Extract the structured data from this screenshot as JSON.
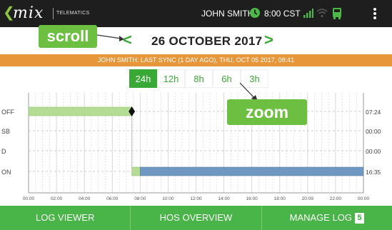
{
  "header": {
    "logo": "mix",
    "brand_sub": "TELEMATICS",
    "user": "JOHN SMITH",
    "time": "8:00 CST",
    "icons": [
      "back-chevron-icon",
      "clock-icon",
      "signal-icon",
      "wifi-icon",
      "truck-icon",
      "overflow-menu-icon"
    ]
  },
  "datebar": {
    "prev": "<",
    "date": "26 OCTOBER 2017",
    "next": ">"
  },
  "callouts": {
    "scroll": "scroll",
    "zoom": "zoom"
  },
  "sync": {
    "text": "JOHN SMITH: LAST SYNC (1 DAY AGO), THU, OCT 05 2017, 08:41"
  },
  "zoom_tabs": [
    {
      "label": "24h",
      "active": true
    },
    {
      "label": "12h",
      "active": false
    },
    {
      "label": "8h",
      "active": false
    },
    {
      "label": "6h",
      "active": false
    },
    {
      "label": "3h",
      "active": false
    }
  ],
  "chart_data": {
    "type": "step",
    "statuses": [
      "OFF",
      "SB",
      "D",
      "ON"
    ],
    "totals": {
      "OFF": "07:24",
      "SB": "00:00",
      "D": "00:00",
      "ON": "16:35"
    },
    "x_ticks": [
      "00:00",
      "02:00",
      "04:00",
      "06:00",
      "08:00",
      "10:00",
      "12:00",
      "14:00",
      "16:00",
      "18:00",
      "20:09",
      "22:00",
      "00:00"
    ],
    "x_range_hours": [
      0,
      24
    ],
    "segments": [
      {
        "status": "OFF",
        "start": 0.0,
        "end": 7.4,
        "style": "past"
      },
      {
        "status": "ON",
        "start": 7.4,
        "end": 8.0,
        "style": "past"
      },
      {
        "status": "ON",
        "start": 8.0,
        "end": 24.0,
        "style": "current"
      }
    ],
    "marker": {
      "status": "OFF",
      "hour": 7.4
    },
    "colors": {
      "past": "#b5dc95",
      "current": "#6e97c2",
      "marker": "#111111",
      "grid": "#d4d4d4"
    }
  },
  "footer": {
    "log_viewer": "LOG VIEWER",
    "hos_overview": "HOS OVERVIEW",
    "manage_log": "MANAGE LOG",
    "manage_badge": "5"
  }
}
